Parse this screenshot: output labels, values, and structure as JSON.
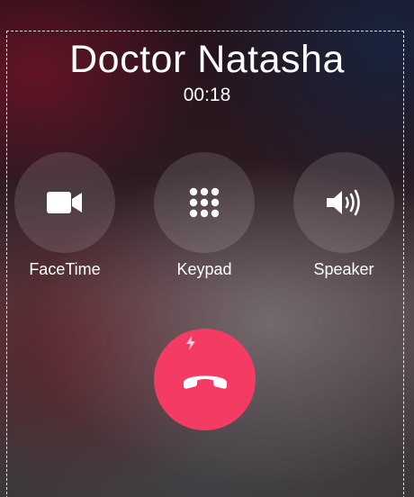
{
  "call": {
    "caller_name": "Doctor Natasha",
    "timer": "00:18"
  },
  "controls": [
    {
      "label": "FaceTime",
      "icon": "video-camera-icon"
    },
    {
      "label": "Keypad",
      "icon": "keypad-grid-icon"
    },
    {
      "label": "Speaker",
      "icon": "speaker-icon"
    }
  ],
  "end_call": {
    "icon": "hang-up-icon",
    "indicator_icon": "lightning-bolt-icon",
    "color": "#f43b63"
  }
}
